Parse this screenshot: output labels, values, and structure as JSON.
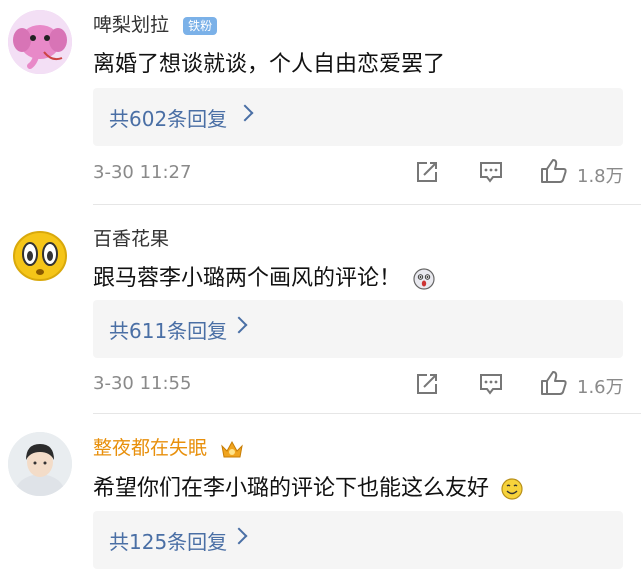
{
  "comments": [
    {
      "username": "啤梨划拉",
      "badge": "铁粉",
      "text": "离婚了想谈就谈，个人自由恋爱罢了",
      "reply_label": "共602条回复",
      "time": "3-30 11:27",
      "likes": "1.8万"
    },
    {
      "username": "百香花果",
      "text": "跟马蓉李小璐两个画风的评论！",
      "reply_label": "共611条回复",
      "time": "3-30 11:55",
      "likes": "1.6万"
    },
    {
      "username": "整夜都在失眠",
      "text": "希望你们在李小璐的评论下也能这么友好",
      "reply_label": "共125条回复"
    }
  ],
  "colors": {
    "link": "#4a6fa5",
    "vip_name": "#e8900c",
    "badge_bg": "#7bb1e8",
    "reply_bg": "#f5f5f5"
  }
}
